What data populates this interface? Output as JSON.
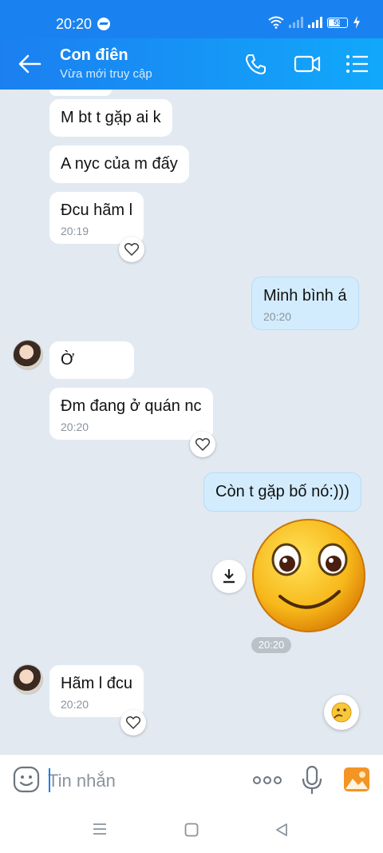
{
  "status_bar": {
    "time": "20:20",
    "battery": "59"
  },
  "header": {
    "title": "Con điên",
    "subtitle": "Vừa mới truy cập"
  },
  "messages": {
    "m1": {
      "text": "M bt t gặp ai k"
    },
    "m2": {
      "text": "A nyc của m đấy"
    },
    "m3": {
      "text": "Đcu hãm l",
      "time": "20:19"
    },
    "m4": {
      "text": "Minh bình á",
      "time": "20:20"
    },
    "m5": {
      "text": "Ờ"
    },
    "m6": {
      "text": "Đm đang ở quán nc",
      "time": "20:20"
    },
    "m7": {
      "text": "Còn t gặp bố nó:)))"
    },
    "m8": {
      "sticker": "smiley-sticker",
      "time": "20:20"
    },
    "m9": {
      "text": "Hãm l đcu",
      "time": "20:20"
    }
  },
  "input": {
    "placeholder": "Tin nhắn",
    "value": ""
  },
  "colors": {
    "primary": "#1a82f0",
    "outgoing_bubble": "#d3ecfd",
    "background": "#e2e9f1"
  }
}
